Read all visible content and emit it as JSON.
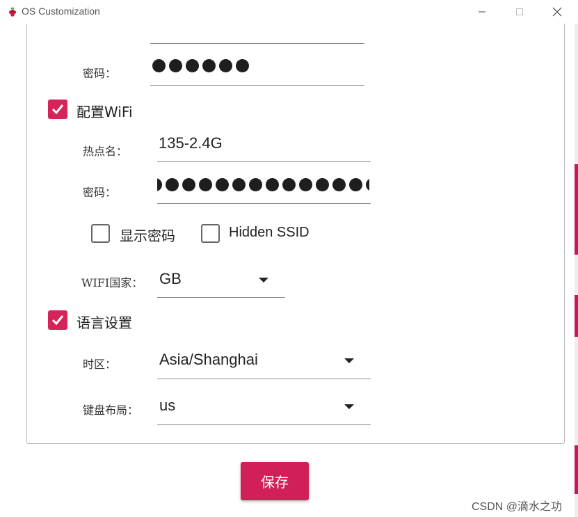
{
  "window": {
    "title": "OS Customization",
    "minimize_glyph": "—",
    "maximize_glyph": "☐",
    "close_glyph": "✕"
  },
  "account": {
    "password_label": "密码：",
    "password_dot_count": 6
  },
  "wifi": {
    "enabled": true,
    "section_label": "配置WiFi",
    "ssid_label": "热点名：",
    "ssid_value": "135-2.4G",
    "password_label": "密码：",
    "password_dot_count": 14,
    "show_password_label": "显示密码",
    "show_password_checked": false,
    "hidden_ssid_label": "Hidden SSID",
    "hidden_ssid_checked": false,
    "country_label": "WIFI国家：",
    "country_value": "GB"
  },
  "locale": {
    "enabled": true,
    "section_label": "语言设置",
    "timezone_label": "时区：",
    "timezone_value": "Asia/Shanghai",
    "keyboard_label": "键盘布局：",
    "keyboard_value": "us"
  },
  "actions": {
    "save_label": "保存"
  },
  "watermark": "CSDN @滴水之功",
  "colors": {
    "accent": "#d6245a",
    "button": "#d12057"
  },
  "icons": {
    "app": "raspberry-icon",
    "check": "checkmark-icon",
    "dropdown": "triangle-down-icon"
  }
}
